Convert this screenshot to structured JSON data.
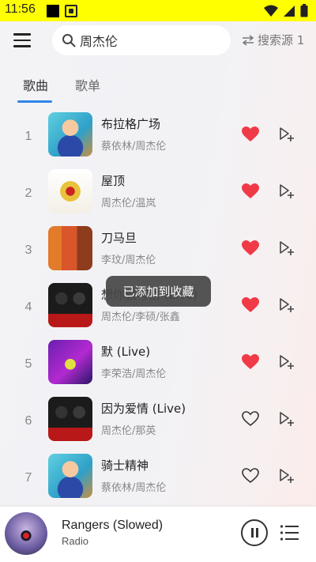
{
  "status_bar": {
    "time": "11:56"
  },
  "header": {
    "search": {
      "value": "周杰伦",
      "placeholder": ""
    },
    "source_button": {
      "label": "搜索源 1"
    }
  },
  "tabs": [
    {
      "label": "歌曲",
      "active": true
    },
    {
      "label": "歌单",
      "active": false
    }
  ],
  "songs": [
    {
      "index": "1",
      "title": "布拉格广场",
      "artist": "蔡依林/周杰伦",
      "liked": true,
      "cover": "cover-a"
    },
    {
      "index": "2",
      "title": "屋顶",
      "artist": "周杰伦/温岚",
      "liked": true,
      "cover": "cover-b"
    },
    {
      "index": "3",
      "title": "刀马旦",
      "artist": "李玟/周杰伦",
      "liked": true,
      "cover": "cover-c"
    },
    {
      "index": "4",
      "title": "想你就写信 (Live)",
      "artist": "周杰伦/李硕/张鑫",
      "liked": true,
      "cover": "cover-d"
    },
    {
      "index": "5",
      "title": "默 (Live)",
      "artist": "李荣浩/周杰伦",
      "liked": true,
      "cover": "cover-e"
    },
    {
      "index": "6",
      "title": "因为爱情 (Live)",
      "artist": "周杰伦/那英",
      "liked": false,
      "cover": "cover-d"
    },
    {
      "index": "7",
      "title": "骑士精神",
      "artist": "蔡依林/周杰伦",
      "liked": false,
      "cover": "cover-a"
    }
  ],
  "toast": {
    "text": "已添加到收藏"
  },
  "player": {
    "title": "Rangers (Slowed)",
    "subtitle": "Radio",
    "state": "playing"
  },
  "colors": {
    "accent": "#2f85e8",
    "liked": "#f03a48",
    "status_bar": "#ffff00"
  }
}
